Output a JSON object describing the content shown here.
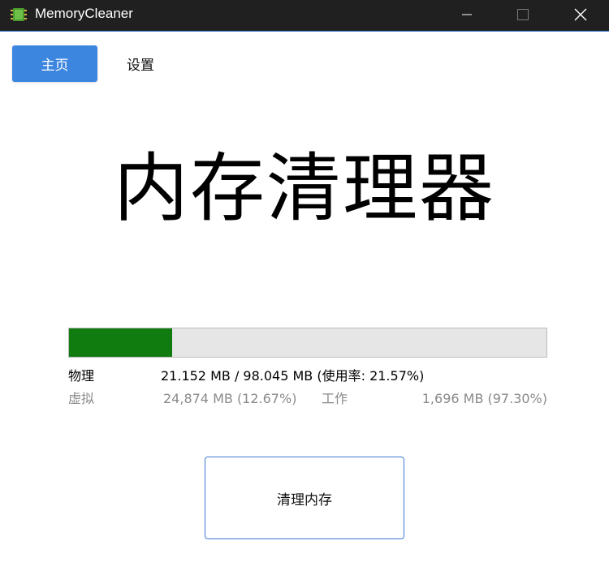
{
  "window": {
    "title": "MemoryCleaner"
  },
  "nav": {
    "home_label": "主页",
    "settings_label": "设置"
  },
  "main": {
    "heading": "内存清理器"
  },
  "memory": {
    "usage_fraction": 0.2157,
    "physical_label": "物理",
    "physical_value": "21.152 MB / 98.045 MB (使用率: 21.57%)",
    "virtual_label": "虚拟",
    "virtual_value": "24,874 MB (12.67%)",
    "working_label": "工作",
    "working_value": "1,696 MB (97.30%)"
  },
  "actions": {
    "clean_label": "清理内存"
  },
  "colors": {
    "accent": "#3c86e0",
    "progress_fill": "#107c10",
    "titlebar": "#202020"
  }
}
